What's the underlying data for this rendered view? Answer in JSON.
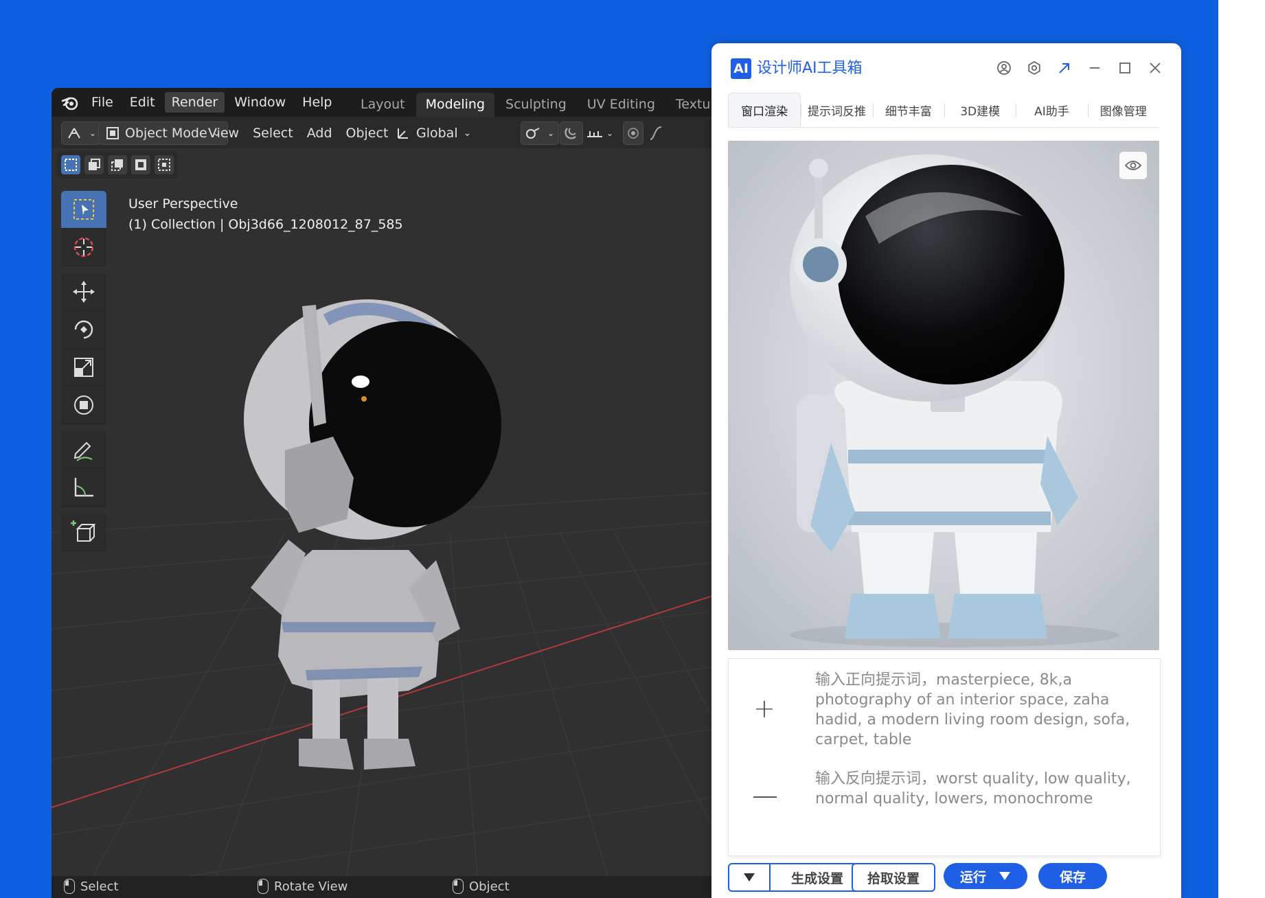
{
  "blender": {
    "menu": [
      "File",
      "Edit",
      "Render",
      "Window",
      "Help"
    ],
    "workspaces": [
      "Layout",
      "Modeling",
      "Sculpting",
      "UV Editing",
      "Textu"
    ],
    "header": {
      "mode": "Object Mode",
      "menus": [
        "View",
        "Select",
        "Add",
        "Object"
      ],
      "orientation": "Global"
    },
    "viewport": {
      "perspective": "User Perspective",
      "collection": "(1) Collection | Obj3d66_1208012_87_585"
    },
    "status": [
      "Select",
      "Rotate View",
      "Object"
    ]
  },
  "ai": {
    "logo": "AI",
    "title": "设计师AI工具箱",
    "tabs": [
      "窗口渲染",
      "提示词反推",
      "细节丰富",
      "3D建模",
      "AI助手",
      "图像管理"
    ],
    "positive_prompt": "输入正向提示词，masterpiece, 8k,a photography of an interior space, zaha hadid, a modern living room design, sofa, carpet, table",
    "negative_prompt": "输入反向提示词，worst quality, low quality, normal quality, lowers, monochrome",
    "buttons": {
      "gen_settings": "生成设置",
      "pick_settings": "拾取设置",
      "run": "运行",
      "save": "保存"
    }
  },
  "colors": {
    "background": "#0f60e0",
    "accent": "#1f5fe6",
    "blender_bg": "#303030"
  }
}
